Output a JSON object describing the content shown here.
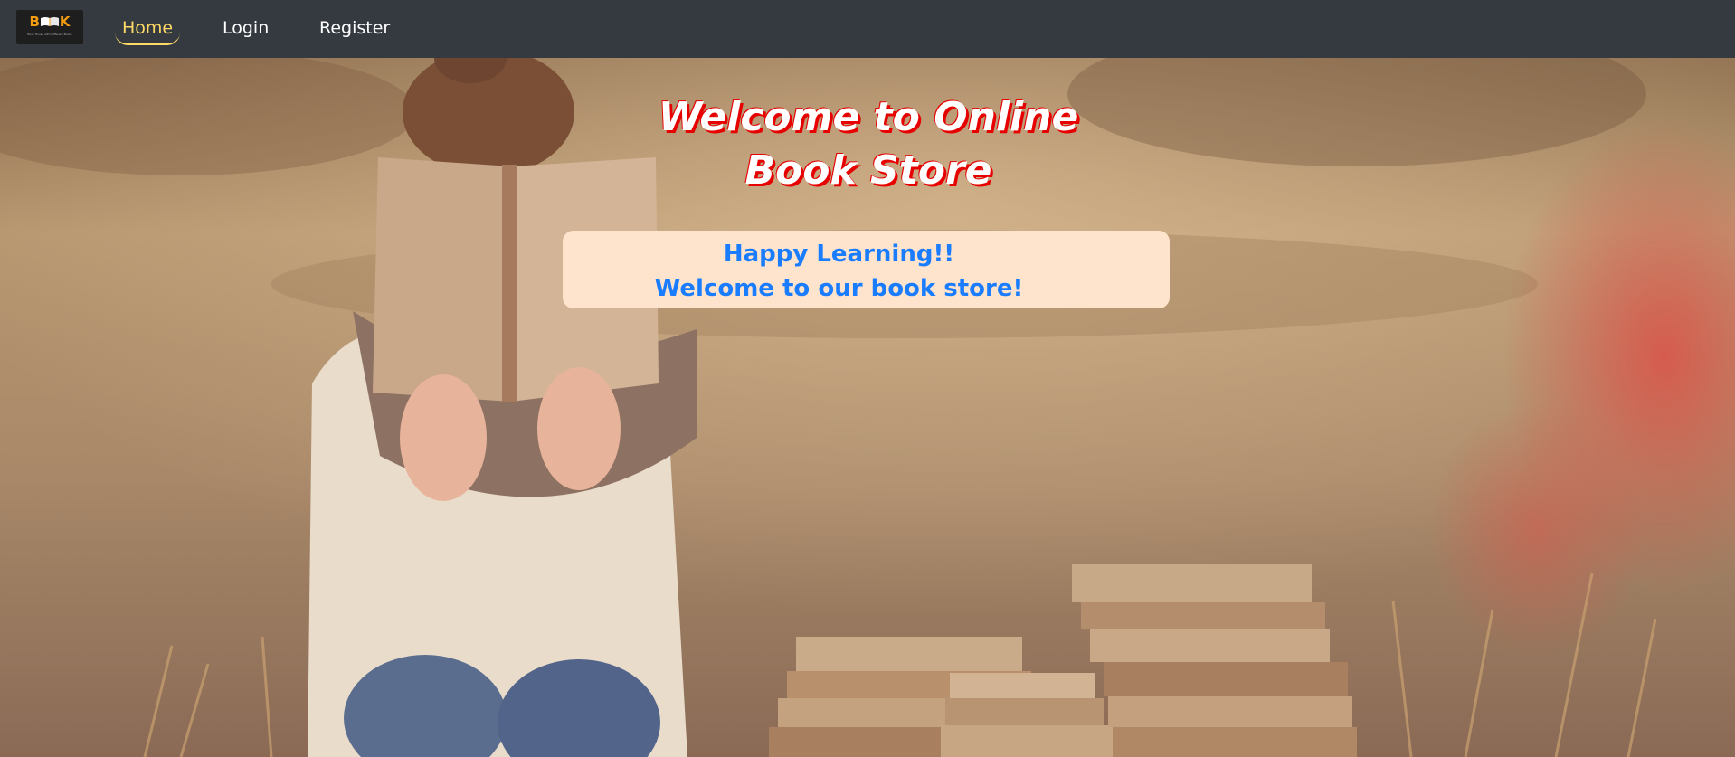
{
  "nav": {
    "logo_text": "BOOK",
    "logo_tagline": "Book House with Different Books",
    "home": "Home",
    "login": "Login",
    "register": "Register"
  },
  "hero": {
    "headline_line1": "Welcome to Online",
    "headline_line2": "Book Store",
    "box_line1": "Happy Learning!!",
    "box_line2": "Welcome to our book store!"
  },
  "colors": {
    "navbar": "#343a40",
    "nav_active": "#ffd966",
    "headline_shadow": "#e60000",
    "box_background": "#ffe4cd",
    "box_text": "#1a7dff",
    "logo_accent": "#f39c12"
  },
  "icons": {
    "logo_glyph": "open-book-icon"
  }
}
